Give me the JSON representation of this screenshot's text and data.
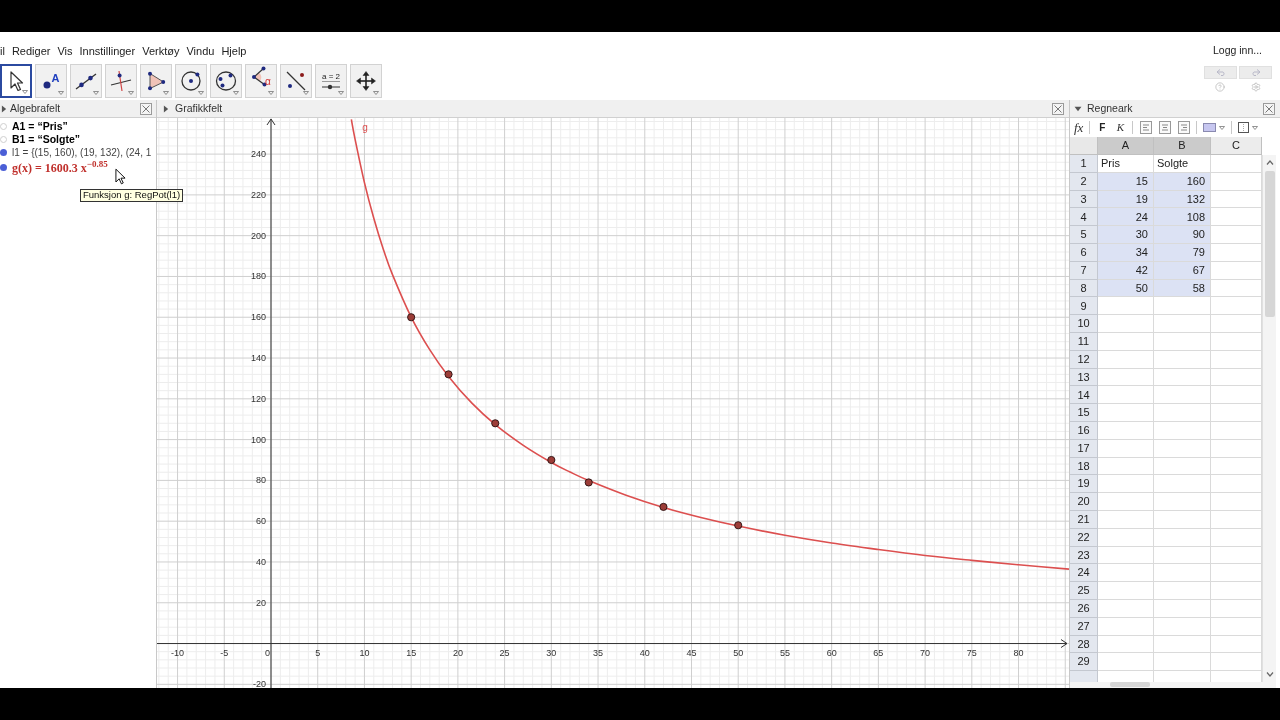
{
  "menu": {
    "items": [
      "il",
      "Rediger",
      "Vis",
      "Innstillinger",
      "Verktøy",
      "Vindu",
      "Hjelp"
    ],
    "login": "Logg inn..."
  },
  "toolbar": {
    "tools": [
      {
        "kind": "move",
        "selected": true
      },
      {
        "kind": "point",
        "label": "A",
        "selected": false
      },
      {
        "kind": "line",
        "selected": false
      },
      {
        "kind": "perpendicular",
        "selected": false
      },
      {
        "kind": "polygon",
        "selected": false
      },
      {
        "kind": "circle",
        "selected": false
      },
      {
        "kind": "conic",
        "selected": false
      },
      {
        "kind": "angle",
        "label": "α",
        "selected": false
      },
      {
        "kind": "reflect",
        "selected": false
      },
      {
        "kind": "slider",
        "label": "a = 2",
        "selected": false
      },
      {
        "kind": "move-view",
        "selected": false
      }
    ],
    "undo": {
      "disabled": true
    },
    "redo": {
      "disabled": true
    }
  },
  "algebra_view": {
    "title": "Algebrafelt",
    "items": [
      {
        "kind": "text",
        "text": "A1 = “Pris”",
        "shown": false,
        "color": "#000000"
      },
      {
        "kind": "text",
        "text": "B1 = “Solgte”",
        "shown": false,
        "color": "#000000"
      },
      {
        "kind": "list",
        "text": "l1 = {(15, 160), (19, 132), (24, 1",
        "shown": true,
        "color": "#444444"
      },
      {
        "kind": "function",
        "text": "g(x) = 1600.3 x$^{−0.85}$",
        "shown": true,
        "color": "#c0302c"
      }
    ]
  },
  "graphics_view": {
    "title": "Grafikkfelt",
    "chart_data": {
      "type": "scatter",
      "grid": true,
      "xlim": [
        -12.2,
        85.4
      ],
      "ylim": [
        -21.8,
        257.7
      ],
      "xticks": [
        -10,
        -5,
        0,
        5,
        10,
        15,
        20,
        25,
        30,
        35,
        40,
        45,
        50,
        55,
        60,
        65,
        70,
        75,
        80
      ],
      "yticks": [
        -20,
        20,
        40,
        60,
        80,
        100,
        120,
        140,
        160,
        180,
        200,
        220,
        240
      ],
      "x": [
        8.6,
        9,
        10,
        11,
        12,
        13,
        15,
        17,
        19,
        21.5,
        24,
        27,
        30,
        32,
        34,
        38,
        42,
        46,
        50,
        55,
        60,
        65,
        70,
        75,
        80,
        85.4
      ],
      "series": [
        {
          "name": "g",
          "type": "line",
          "color": "#dc4f4f",
          "values": [
            257.0,
            247.2,
            226.0,
            208.5,
            193.6,
            180.9,
            160.1,
            144.0,
            131.0,
            117.9,
            107.4,
            97.2,
            88.8,
            84.1,
            79.9,
            72.7,
            66.7,
            61.8,
            57.6,
            53.1,
            49.3,
            46.1,
            43.2,
            40.8,
            38.6,
            36.5
          ]
        },
        {
          "color": "#9c3d38",
          "values": [
            null,
            null,
            null,
            null,
            null,
            null,
            160,
            null,
            132,
            null,
            108,
            null,
            90,
            null,
            79,
            null,
            67,
            null,
            58,
            null,
            null,
            null,
            null,
            null,
            null,
            null
          ]
        }
      ]
    }
  },
  "spreadsheet": {
    "title": "Regneark",
    "toolbar": [
      {
        "kind": "formula",
        "label": "fx"
      },
      {
        "kind": "bold",
        "label": "F"
      },
      {
        "kind": "italic",
        "label": "K"
      },
      {
        "kind": "align-left"
      },
      {
        "kind": "align-center"
      },
      {
        "kind": "align-right"
      },
      {
        "kind": "fill-color"
      },
      {
        "kind": "border"
      }
    ],
    "columns": [
      {
        "label": "A",
        "selected": true
      },
      {
        "label": "B",
        "selected": true
      },
      {
        "label": "C",
        "selected": false
      }
    ],
    "rows": [
      {
        "label": "1",
        "cells": [
          {
            "kind": "text",
            "value": "Pris",
            "selected": false
          },
          {
            "kind": "text",
            "value": "Solgte",
            "selected": false
          }
        ]
      },
      {
        "label": "2",
        "cells": [
          {
            "kind": "number",
            "value": "15",
            "selected": true
          },
          {
            "kind": "number",
            "value": "160",
            "selected": true
          }
        ]
      },
      {
        "label": "3",
        "cells": [
          {
            "kind": "number",
            "value": "19",
            "selected": true
          },
          {
            "kind": "number",
            "value": "132",
            "selected": true
          }
        ]
      },
      {
        "label": "4",
        "cells": [
          {
            "kind": "number",
            "value": "24",
            "selected": true
          },
          {
            "kind": "number",
            "value": "108",
            "selected": true
          }
        ]
      },
      {
        "label": "5",
        "cells": [
          {
            "kind": "number",
            "value": "30",
            "selected": true
          },
          {
            "kind": "number",
            "value": "90",
            "selected": true
          }
        ]
      },
      {
        "label": "6",
        "cells": [
          {
            "kind": "number",
            "value": "34",
            "selected": true
          },
          {
            "kind": "number",
            "value": "79",
            "selected": true
          }
        ]
      },
      {
        "label": "7",
        "cells": [
          {
            "kind": "number",
            "value": "42",
            "selected": true
          },
          {
            "kind": "number",
            "value": "67",
            "selected": true
          }
        ]
      },
      {
        "label": "8",
        "cells": [
          {
            "kind": "number",
            "value": "50",
            "selected": true
          },
          {
            "kind": "number",
            "value": "58",
            "selected": true
          }
        ]
      },
      {
        "label": "9"
      },
      {
        "label": "10"
      },
      {
        "label": "11"
      },
      {
        "label": "12"
      },
      {
        "label": "13"
      },
      {
        "label": "14"
      },
      {
        "label": "15"
      },
      {
        "label": "16"
      },
      {
        "label": "17"
      },
      {
        "label": "18"
      },
      {
        "label": "19"
      },
      {
        "label": "20"
      },
      {
        "label": "21"
      },
      {
        "label": "22"
      },
      {
        "label": "23"
      },
      {
        "label": "24"
      },
      {
        "label": "25"
      },
      {
        "label": "26"
      },
      {
        "label": "27"
      },
      {
        "label": "28"
      },
      {
        "label": "29"
      }
    ]
  },
  "tooltip": {
    "text": "Funksjon g: RegPot(l1)"
  }
}
